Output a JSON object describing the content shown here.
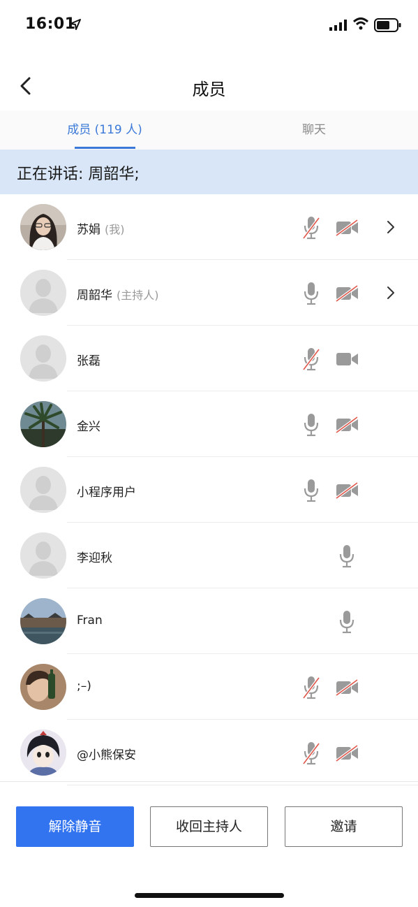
{
  "status_bar": {
    "time": "16:01"
  },
  "nav": {
    "title": "成员"
  },
  "tabs": [
    {
      "label": "成员 (119 人)",
      "active": true
    },
    {
      "label": "聊天",
      "active": false
    }
  ],
  "speaking": {
    "text": "正在讲话: 周韶华;"
  },
  "members": [
    {
      "name": "苏娟",
      "role": "(我)",
      "mic": "muted",
      "camera": "off",
      "chevron": true,
      "avatar": "photo-woman-glasses"
    },
    {
      "name": "周韶华",
      "role": "(主持人)",
      "mic": "on",
      "camera": "off",
      "chevron": true,
      "avatar": "default-avatar"
    },
    {
      "name": "张磊",
      "role": "",
      "mic": "muted",
      "camera": "on",
      "chevron": false,
      "avatar": "default-avatar"
    },
    {
      "name": "金兴",
      "role": "",
      "mic": "on",
      "camera": "off",
      "chevron": false,
      "avatar": "photo-palm-tree"
    },
    {
      "name": "小程序用户",
      "role": "",
      "mic": "on",
      "camera": "off",
      "chevron": false,
      "avatar": "default-avatar"
    },
    {
      "name": "李迎秋",
      "role": "",
      "mic": "on",
      "camera": "none",
      "chevron": false,
      "avatar": "default-avatar"
    },
    {
      "name": "Fran",
      "role": "",
      "mic": "on",
      "camera": "none",
      "chevron": false,
      "avatar": "photo-canal-town"
    },
    {
      "name": ";–)",
      "role": "",
      "mic": "muted",
      "camera": "off",
      "chevron": false,
      "avatar": "photo-selfie-bottle"
    },
    {
      "name": "@小熊保安",
      "role": "",
      "mic": "muted",
      "camera": "off",
      "chevron": false,
      "avatar": "anime-character"
    }
  ],
  "buttons": {
    "unmute": "解除静音",
    "revoke_host": "收回主持人",
    "invite": "邀请"
  },
  "colors": {
    "accent": "#3b79d8",
    "primary_button": "#3274f0",
    "banner_bg": "#d9e6f7",
    "muted_slash": "#e0564a",
    "icon_gray": "#9a9a9a"
  }
}
